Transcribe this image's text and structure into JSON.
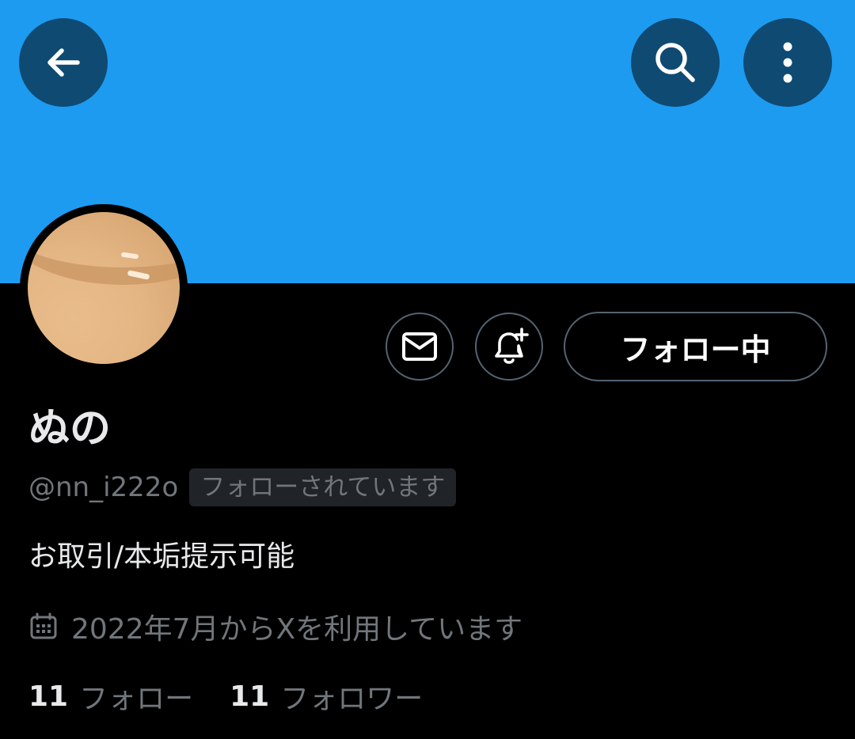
{
  "colors": {
    "banner": "#1d9bf0",
    "header_button_bg": "#0f4a72",
    "text_primary": "#e7e9ea",
    "text_secondary": "#71767b",
    "border": "#536471",
    "badge_bg": "#202327"
  },
  "header": {
    "back_icon": "arrow-left-icon",
    "search_icon": "search-icon",
    "more_icon": "more-vertical-icon"
  },
  "actions": {
    "dm_icon": "mail-icon",
    "notify_icon": "bell-plus-icon",
    "following_label": "フォロー中"
  },
  "profile": {
    "display_name": "ぬの",
    "handle": "@nn_i222o",
    "follows_you_badge": "フォローされています",
    "bio": "お取引/本垢提示可能",
    "joined_icon": "calendar-icon",
    "joined": "2022年7月からXを利用しています"
  },
  "stats": {
    "following_count": "11",
    "following_label": "フォロー",
    "followers_count": "11",
    "followers_label": "フォロワー"
  }
}
